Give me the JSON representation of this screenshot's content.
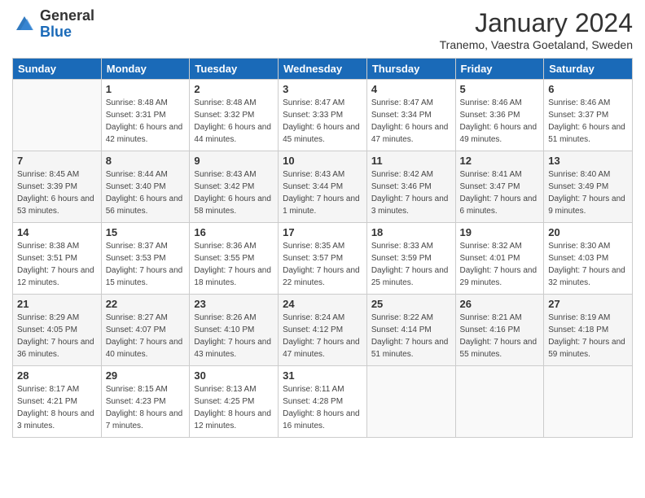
{
  "logo": {
    "general": "General",
    "blue": "Blue"
  },
  "header": {
    "month": "January 2024",
    "location": "Tranemo, Vaestra Goetaland, Sweden"
  },
  "weekdays": [
    "Sunday",
    "Monday",
    "Tuesday",
    "Wednesday",
    "Thursday",
    "Friday",
    "Saturday"
  ],
  "weeks": [
    [
      {
        "day": null,
        "info": null
      },
      {
        "day": "1",
        "sunrise": "Sunrise: 8:48 AM",
        "sunset": "Sunset: 3:31 PM",
        "daylight": "Daylight: 6 hours and 42 minutes."
      },
      {
        "day": "2",
        "sunrise": "Sunrise: 8:48 AM",
        "sunset": "Sunset: 3:32 PM",
        "daylight": "Daylight: 6 hours and 44 minutes."
      },
      {
        "day": "3",
        "sunrise": "Sunrise: 8:47 AM",
        "sunset": "Sunset: 3:33 PM",
        "daylight": "Daylight: 6 hours and 45 minutes."
      },
      {
        "day": "4",
        "sunrise": "Sunrise: 8:47 AM",
        "sunset": "Sunset: 3:34 PM",
        "daylight": "Daylight: 6 hours and 47 minutes."
      },
      {
        "day": "5",
        "sunrise": "Sunrise: 8:46 AM",
        "sunset": "Sunset: 3:36 PM",
        "daylight": "Daylight: 6 hours and 49 minutes."
      },
      {
        "day": "6",
        "sunrise": "Sunrise: 8:46 AM",
        "sunset": "Sunset: 3:37 PM",
        "daylight": "Daylight: 6 hours and 51 minutes."
      }
    ],
    [
      {
        "day": "7",
        "sunrise": "Sunrise: 8:45 AM",
        "sunset": "Sunset: 3:39 PM",
        "daylight": "Daylight: 6 hours and 53 minutes."
      },
      {
        "day": "8",
        "sunrise": "Sunrise: 8:44 AM",
        "sunset": "Sunset: 3:40 PM",
        "daylight": "Daylight: 6 hours and 56 minutes."
      },
      {
        "day": "9",
        "sunrise": "Sunrise: 8:43 AM",
        "sunset": "Sunset: 3:42 PM",
        "daylight": "Daylight: 6 hours and 58 minutes."
      },
      {
        "day": "10",
        "sunrise": "Sunrise: 8:43 AM",
        "sunset": "Sunset: 3:44 PM",
        "daylight": "Daylight: 7 hours and 1 minute."
      },
      {
        "day": "11",
        "sunrise": "Sunrise: 8:42 AM",
        "sunset": "Sunset: 3:46 PM",
        "daylight": "Daylight: 7 hours and 3 minutes."
      },
      {
        "day": "12",
        "sunrise": "Sunrise: 8:41 AM",
        "sunset": "Sunset: 3:47 PM",
        "daylight": "Daylight: 7 hours and 6 minutes."
      },
      {
        "day": "13",
        "sunrise": "Sunrise: 8:40 AM",
        "sunset": "Sunset: 3:49 PM",
        "daylight": "Daylight: 7 hours and 9 minutes."
      }
    ],
    [
      {
        "day": "14",
        "sunrise": "Sunrise: 8:38 AM",
        "sunset": "Sunset: 3:51 PM",
        "daylight": "Daylight: 7 hours and 12 minutes."
      },
      {
        "day": "15",
        "sunrise": "Sunrise: 8:37 AM",
        "sunset": "Sunset: 3:53 PM",
        "daylight": "Daylight: 7 hours and 15 minutes."
      },
      {
        "day": "16",
        "sunrise": "Sunrise: 8:36 AM",
        "sunset": "Sunset: 3:55 PM",
        "daylight": "Daylight: 7 hours and 18 minutes."
      },
      {
        "day": "17",
        "sunrise": "Sunrise: 8:35 AM",
        "sunset": "Sunset: 3:57 PM",
        "daylight": "Daylight: 7 hours and 22 minutes."
      },
      {
        "day": "18",
        "sunrise": "Sunrise: 8:33 AM",
        "sunset": "Sunset: 3:59 PM",
        "daylight": "Daylight: 7 hours and 25 minutes."
      },
      {
        "day": "19",
        "sunrise": "Sunrise: 8:32 AM",
        "sunset": "Sunset: 4:01 PM",
        "daylight": "Daylight: 7 hours and 29 minutes."
      },
      {
        "day": "20",
        "sunrise": "Sunrise: 8:30 AM",
        "sunset": "Sunset: 4:03 PM",
        "daylight": "Daylight: 7 hours and 32 minutes."
      }
    ],
    [
      {
        "day": "21",
        "sunrise": "Sunrise: 8:29 AM",
        "sunset": "Sunset: 4:05 PM",
        "daylight": "Daylight: 7 hours and 36 minutes."
      },
      {
        "day": "22",
        "sunrise": "Sunrise: 8:27 AM",
        "sunset": "Sunset: 4:07 PM",
        "daylight": "Daylight: 7 hours and 40 minutes."
      },
      {
        "day": "23",
        "sunrise": "Sunrise: 8:26 AM",
        "sunset": "Sunset: 4:10 PM",
        "daylight": "Daylight: 7 hours and 43 minutes."
      },
      {
        "day": "24",
        "sunrise": "Sunrise: 8:24 AM",
        "sunset": "Sunset: 4:12 PM",
        "daylight": "Daylight: 7 hours and 47 minutes."
      },
      {
        "day": "25",
        "sunrise": "Sunrise: 8:22 AM",
        "sunset": "Sunset: 4:14 PM",
        "daylight": "Daylight: 7 hours and 51 minutes."
      },
      {
        "day": "26",
        "sunrise": "Sunrise: 8:21 AM",
        "sunset": "Sunset: 4:16 PM",
        "daylight": "Daylight: 7 hours and 55 minutes."
      },
      {
        "day": "27",
        "sunrise": "Sunrise: 8:19 AM",
        "sunset": "Sunset: 4:18 PM",
        "daylight": "Daylight: 7 hours and 59 minutes."
      }
    ],
    [
      {
        "day": "28",
        "sunrise": "Sunrise: 8:17 AM",
        "sunset": "Sunset: 4:21 PM",
        "daylight": "Daylight: 8 hours and 3 minutes."
      },
      {
        "day": "29",
        "sunrise": "Sunrise: 8:15 AM",
        "sunset": "Sunset: 4:23 PM",
        "daylight": "Daylight: 8 hours and 7 minutes."
      },
      {
        "day": "30",
        "sunrise": "Sunrise: 8:13 AM",
        "sunset": "Sunset: 4:25 PM",
        "daylight": "Daylight: 8 hours and 12 minutes."
      },
      {
        "day": "31",
        "sunrise": "Sunrise: 8:11 AM",
        "sunset": "Sunset: 4:28 PM",
        "daylight": "Daylight: 8 hours and 16 minutes."
      },
      {
        "day": null,
        "info": null
      },
      {
        "day": null,
        "info": null
      },
      {
        "day": null,
        "info": null
      }
    ]
  ]
}
